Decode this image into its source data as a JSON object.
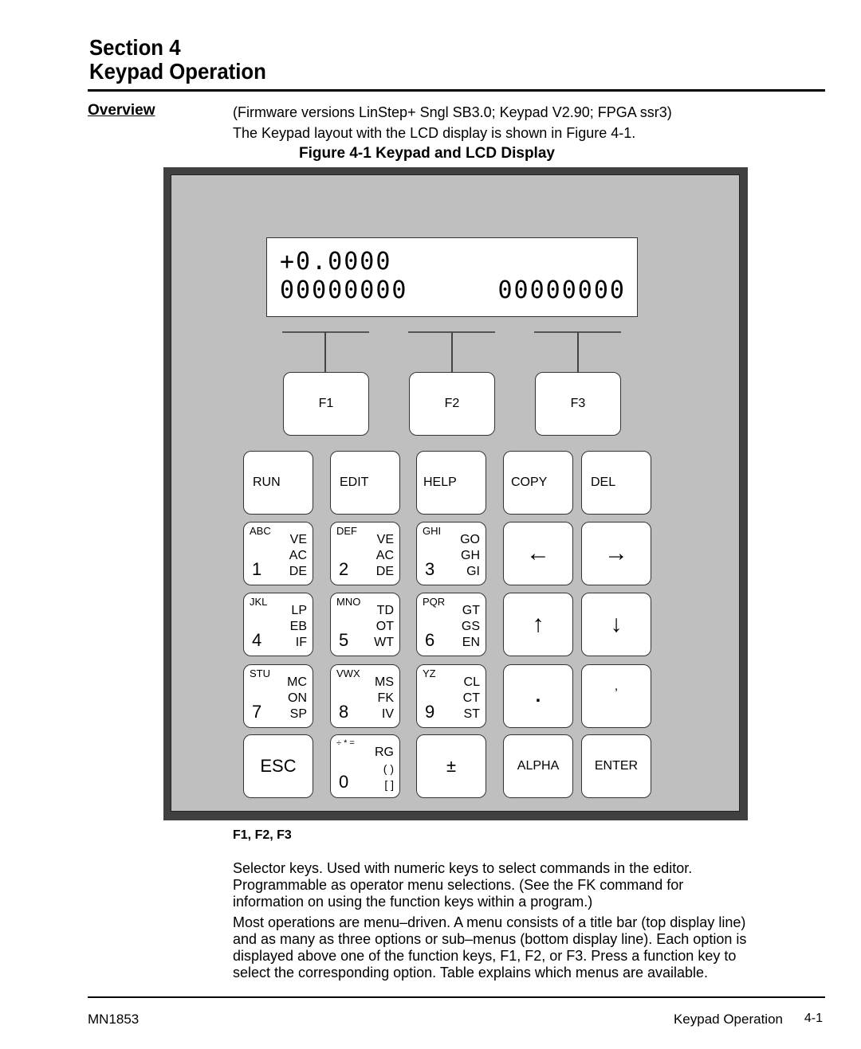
{
  "header": {
    "section_line": "Section 4",
    "title_line": "Keypad Operation"
  },
  "overview": {
    "heading": "Overview",
    "firmware_note": "(Firmware versions LinStep+ Sngl SB3.0; Keypad V2.90; FPGA ssr3)",
    "intro": "The Keypad layout with the LCD display is shown in Figure 4-1.",
    "figure_caption": "Figure 4-1  Keypad and LCD Display"
  },
  "lcd": {
    "line1": "+0.0000",
    "line2_left": "00000000",
    "line2_right": "00000000"
  },
  "function_keys": [
    {
      "label": "F1"
    },
    {
      "label": "F2"
    },
    {
      "label": "F3"
    }
  ],
  "keys": {
    "row1": [
      {
        "label": "RUN"
      },
      {
        "label": "EDIT"
      },
      {
        "label": "HELP"
      },
      {
        "label": "COPY"
      },
      {
        "label": "DEL"
      }
    ],
    "row2": [
      {
        "letters": "ABC",
        "number": "1",
        "cmds": [
          "VE",
          "AC",
          "DE"
        ]
      },
      {
        "letters": "DEF",
        "number": "2",
        "cmds": [
          "VE",
          "AC",
          "DE"
        ]
      },
      {
        "letters": "GHI",
        "number": "3",
        "cmds": [
          "GO",
          "GH",
          "GI"
        ]
      },
      {
        "symbol": "←",
        "icon": "arrow-left-icon"
      },
      {
        "symbol": "→",
        "icon": "arrow-right-icon"
      }
    ],
    "row3": [
      {
        "letters": "JKL",
        "number": "4",
        "cmds": [
          "LP",
          "EB",
          "IF"
        ]
      },
      {
        "letters": "MNO",
        "number": "5",
        "cmds": [
          "TD",
          "OT",
          "WT"
        ]
      },
      {
        "letters": "PQR",
        "number": "6",
        "cmds": [
          "GT",
          "GS",
          "EN"
        ]
      },
      {
        "symbol": "↑",
        "icon": "arrow-up-icon"
      },
      {
        "symbol": "↓",
        "icon": "arrow-down-icon"
      }
    ],
    "row4": [
      {
        "letters": "STU",
        "number": "7",
        "cmds": [
          "MC",
          "ON",
          "SP"
        ]
      },
      {
        "letters": "VWX",
        "number": "8",
        "cmds": [
          "MS",
          "FK",
          "IV"
        ]
      },
      {
        "letters": "YZ",
        "number": "9",
        "cmds": [
          "CL",
          "CT",
          "ST"
        ]
      },
      {
        "symbol": "."
      },
      {
        "symbol": ","
      }
    ],
    "row5": [
      {
        "label": "ESC"
      },
      {
        "letters": "÷ * =",
        "number": "0",
        "cmds": [
          "RG",
          "( )",
          "[ ]"
        ]
      },
      {
        "symbol": "±"
      },
      {
        "label": "ALPHA"
      },
      {
        "label": "ENTER"
      }
    ]
  },
  "description": {
    "heading": "F1, F2, F3",
    "para1_lines": [
      "Selector keys. Used with numeric keys to select commands in the editor.",
      "Programmable as operator menu selections. (See the FK command for",
      "information on using the function keys within a program.)"
    ],
    "para2_lines": [
      "Most operations are menu–driven. A menu consists of a title bar (top display line)",
      "and as many as three options or sub–menus (bottom display line). Each option is",
      "displayed above one of the function keys, F1, F2, or F3. Press a function key to",
      "select the corresponding option.  Table explains which menus are available."
    ]
  },
  "footer": {
    "doc_number": "MN1853",
    "section_name": "Keypad Operation",
    "page": "4-1"
  }
}
